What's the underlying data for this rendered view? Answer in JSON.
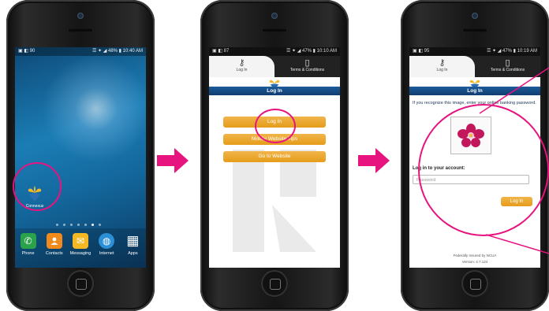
{
  "phone1": {
    "status": {
      "left": "▣ ◧ 90",
      "right": "☰ ✦ ◢ 48% ▮ 10:40 AM"
    },
    "app_label": "Connexus",
    "dock": [
      {
        "label": "Phone",
        "icon": "phone-icon",
        "color": "#2aa14b",
        "glyph": "✆"
      },
      {
        "label": "Contacts",
        "icon": "contacts-icon",
        "color": "#f08a1c",
        "glyph": "👤"
      },
      {
        "label": "Messaging",
        "icon": "messaging-icon",
        "color": "#f3b824",
        "glyph": "✉"
      },
      {
        "label": "Internet",
        "icon": "internet-icon",
        "color": "#2a8fd6",
        "glyph": "◍"
      },
      {
        "label": "Apps",
        "icon": "apps-grid-icon",
        "color": "transparent",
        "glyph": "▦"
      }
    ]
  },
  "phone2": {
    "status": {
      "left": "▣ ◧ 87",
      "right": "☰ ✦ ◢ 47% ▮ 10:10 AM"
    },
    "tabs": [
      "Log In",
      "Terms & Conditions"
    ],
    "title": "Log In",
    "buttons": [
      "Log In",
      "Mobile Website Tips",
      "Go to Website"
    ]
  },
  "phone3": {
    "status": {
      "left": "▣ ◧ 95",
      "right": "☰ ✦ ◢ 47% ▮ 10:19 AM"
    },
    "tabs": [
      "Log In",
      "Terms & Conditions"
    ],
    "title": "Log In",
    "info": "If you recognize this image, enter your online banking password.",
    "login_label": "Log in to your account:",
    "password_placeholder": "Password",
    "login_button": "Log In",
    "footer1": "Federally Insured by NCUA",
    "footer2": "Version: 4.7.124"
  },
  "colors": {
    "accent": "#e7137f",
    "button": "#e69c1a",
    "titlebar": "#0f3d70"
  }
}
